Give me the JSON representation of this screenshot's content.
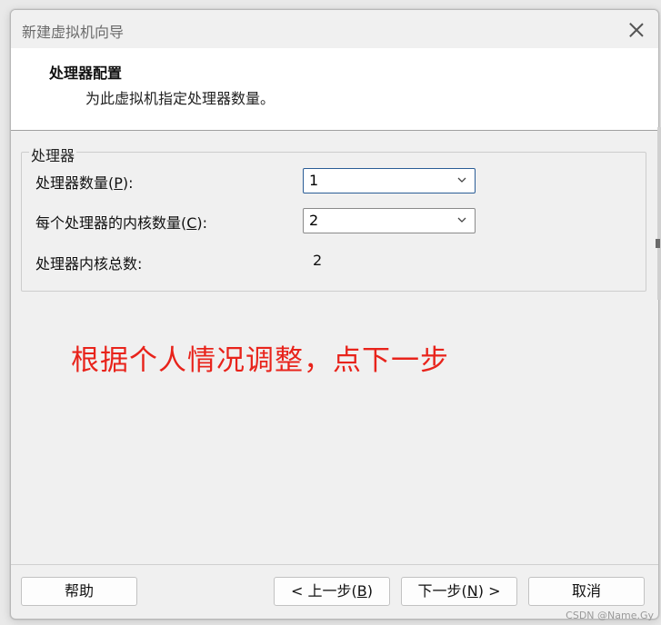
{
  "window": {
    "title": "新建虚拟机向导",
    "close_icon": "close-icon"
  },
  "header": {
    "title": "处理器配置",
    "subtitle": "为此虚拟机指定处理器数量。"
  },
  "processor_group": {
    "legend": "处理器",
    "processor_count": {
      "label_prefix": "处理器数量(",
      "label_key": "P",
      "label_suffix": "):",
      "value": "1"
    },
    "cores_per_processor": {
      "label_prefix": "每个处理器的内核数量(",
      "label_key": "C",
      "label_suffix": "):",
      "value": "2"
    },
    "total_cores": {
      "label": "处理器内核总数:",
      "value": "2"
    }
  },
  "annotation": {
    "text": "根据个人情况调整，点下一步",
    "color": "#e8231b"
  },
  "buttons": {
    "help": "帮助",
    "back_prefix": "< 上一步(",
    "back_key": "B",
    "back_suffix": ")",
    "next_prefix": "下一步(",
    "next_key": "N",
    "next_suffix": ") >",
    "cancel": "取消"
  },
  "watermark": "CSDN @Name.Gy"
}
